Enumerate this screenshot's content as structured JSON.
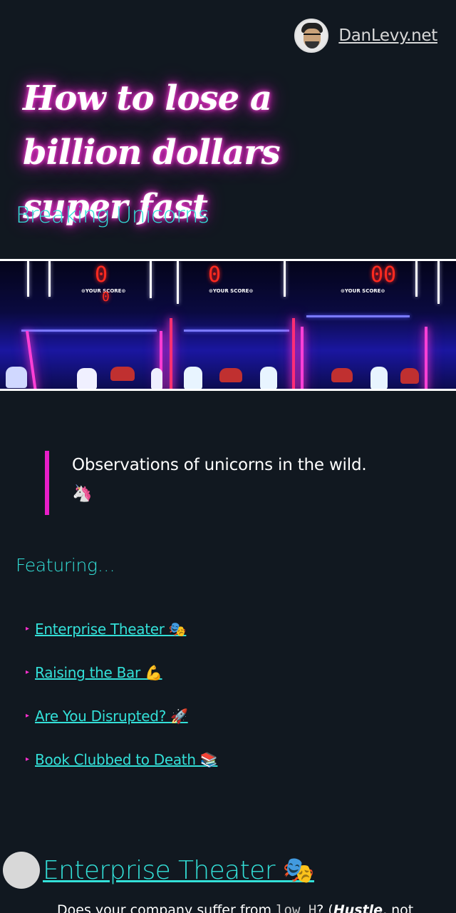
{
  "header": {
    "site_name": "DanLevy.net",
    "title": "How to lose a billion dollars super fast",
    "subtitle": "Breaking Unicorns"
  },
  "hero": {
    "scores": [
      "0",
      "0",
      "00"
    ],
    "sub_score": "0",
    "score_label": "⊙YOUR SCORE⊙"
  },
  "quote": {
    "text": "Observations of unicorns in the wild.",
    "emoji": "🦄"
  },
  "featuring": {
    "heading": "Featuring…",
    "items": [
      {
        "label": "Enterprise Theater 🎭"
      },
      {
        "label": "Raising the Bar 💪"
      },
      {
        "label": "Are You Disrupted? 🚀"
      },
      {
        "label": "Book Clubbed to Death 📚"
      }
    ]
  },
  "section": {
    "title": "Enterprise Theater 🎭",
    "para_start": "Does your company suffer from ",
    "para_code": "low H",
    "para_mid": "? (",
    "para_em": "Hustle",
    "para_end": ", not"
  },
  "colors": {
    "background": "#111820",
    "accent": "#33e0d8",
    "neon_pink": "#e81ec8"
  }
}
